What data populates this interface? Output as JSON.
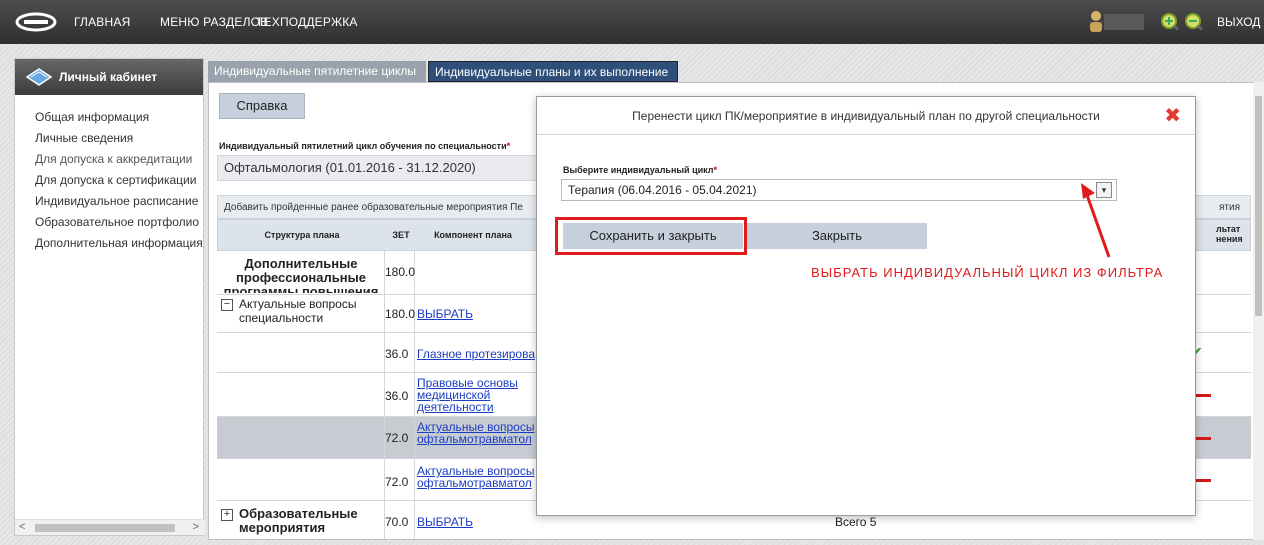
{
  "topbar": {
    "nav": [
      "ГЛАВНАЯ",
      "МЕНЮ РАЗДЕЛОВ",
      "ТЕХПОДДЕРЖКА"
    ],
    "exit_label": "ВЫХОД",
    "icons": [
      "logo-icon",
      "user-icon",
      "zoom-in-icon",
      "zoom-out-icon"
    ]
  },
  "sidebar": {
    "title": "Личный кабинет",
    "items": [
      {
        "label": "Общая информация"
      },
      {
        "label": "Личные сведения"
      },
      {
        "label": "Для допуска к аккредитации"
      },
      {
        "label": "Для допуска к сертификации"
      },
      {
        "label": "Индивидуальное расписание"
      },
      {
        "label": "Образовательное портфолио"
      },
      {
        "label": "Дополнительная информация"
      }
    ]
  },
  "tabs": [
    {
      "label": "Индивидуальные пятилетние циклы"
    },
    {
      "label": "Индивидуальные планы и их выполнение"
    }
  ],
  "main": {
    "help_label": "Справка",
    "field_label": "Индивидуальный пятилетний цикл обучения по специальности",
    "field_value": "Офтальмология (01.01.2016 - 31.12.2020)",
    "toolbar_text": "Добавить пройденные ранее образовательные мероприятия   Пе",
    "toolbar_right": "ятия",
    "headers": {
      "structure": "Структура плана",
      "zet": "ЗЕТ",
      "component": "Компонент плана",
      "result": "льтат\nнения"
    },
    "rows": [
      {
        "title": "Дополнительные профессиональные программы повышения",
        "zet": "180.0",
        "link": ""
      },
      {
        "title": "Актуальные вопросы специальности",
        "zet": "180.0",
        "link": "ВЫБРАТЬ"
      },
      {
        "title": "",
        "zet": "36.0",
        "link": "Глазное протезирова"
      },
      {
        "title": "",
        "zet": "36.0",
        "link": "Правовые основы медицинской деятельности"
      },
      {
        "title": "",
        "zet": "72.0",
        "link": "Актуальные вопросы офтальмотравматол"
      },
      {
        "title": "",
        "zet": "72.0",
        "link": "Актуальные вопросы офтальмотравматол"
      },
      {
        "title": "Образовательные мероприятия",
        "zet": "70.0",
        "link": "ВЫБРАТЬ",
        "total": "Всего 5"
      }
    ]
  },
  "modal": {
    "title": "Перенести цикл ПК/мероприятие в индивидуальный план по другой специальности",
    "select_label": "Выберите индивидуальный цикл",
    "select_value": "Терапия (06.04.2016 - 05.04.2021)",
    "save_label": "Сохранить и закрыть",
    "close_label": "Закрыть",
    "annotation": "ВЫБРАТЬ ИНДИВИДУАЛЬНЫЙ ЦИКЛ ИЗ ФИЛЬТРА",
    "accent": "#e01b1b"
  }
}
